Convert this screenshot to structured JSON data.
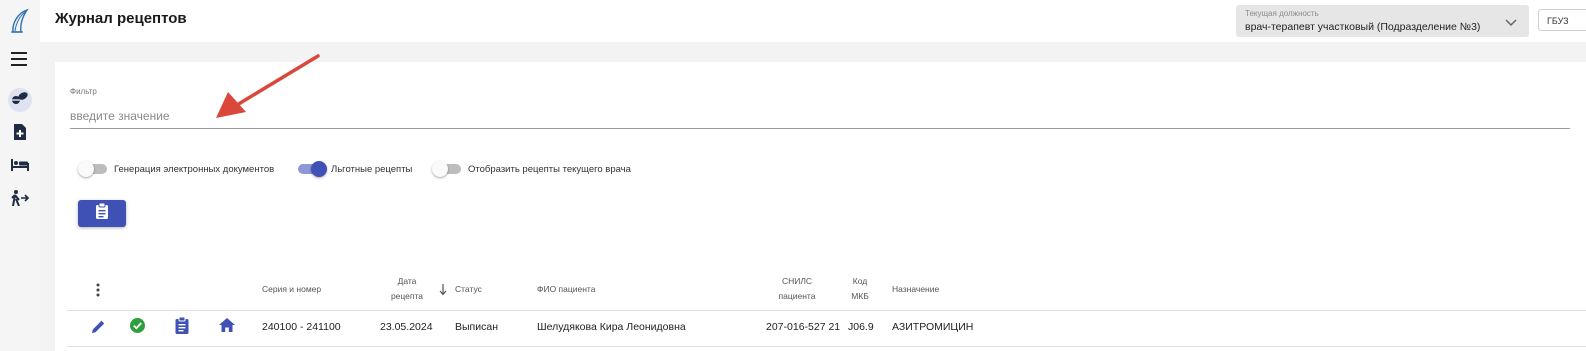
{
  "header": {
    "title": "Журнал рецептов",
    "position_label": "Текущая должность",
    "position_value": "врач-терапевт участковый (Подразделение №3)",
    "org_button": "ГБУЗ"
  },
  "sidebar": {
    "items": [
      {
        "icon": "pills-icon"
      },
      {
        "icon": "medical-file-icon"
      },
      {
        "icon": "bed-icon"
      },
      {
        "icon": "patient-transfer-icon"
      }
    ]
  },
  "filter": {
    "label": "Фильтр",
    "placeholder": "введите значение"
  },
  "toggles": [
    {
      "label": "Генерация электронных документов",
      "on": false
    },
    {
      "label": "Льготные рецепты",
      "on": true
    },
    {
      "label": "Отобразить рецепты текущего врача",
      "on": false
    }
  ],
  "table": {
    "columns": {
      "series": "Серия и номер",
      "date_line1": "Дата",
      "date_line2": "рецепта",
      "status": "Статус",
      "patient": "ФИО пациента",
      "snils_line1": "СНИЛС",
      "snils_line2": "пациента",
      "mkb_line1": "Код",
      "mkb_line2": "МКБ",
      "purpose": "Назначение"
    },
    "rows": [
      {
        "series": "240100 - 241100",
        "date": "23.05.2024",
        "status": "Выписан",
        "patient": "Шелудякова Кира Леонидовна",
        "snils": "207-016-527 21",
        "mkb": "J06.9",
        "purpose": "АЗИТРОМИЦИН"
      }
    ]
  },
  "colors": {
    "accent": "#3f51b5",
    "success": "#2e9e3e",
    "annotation_arrow": "#d9483b"
  }
}
